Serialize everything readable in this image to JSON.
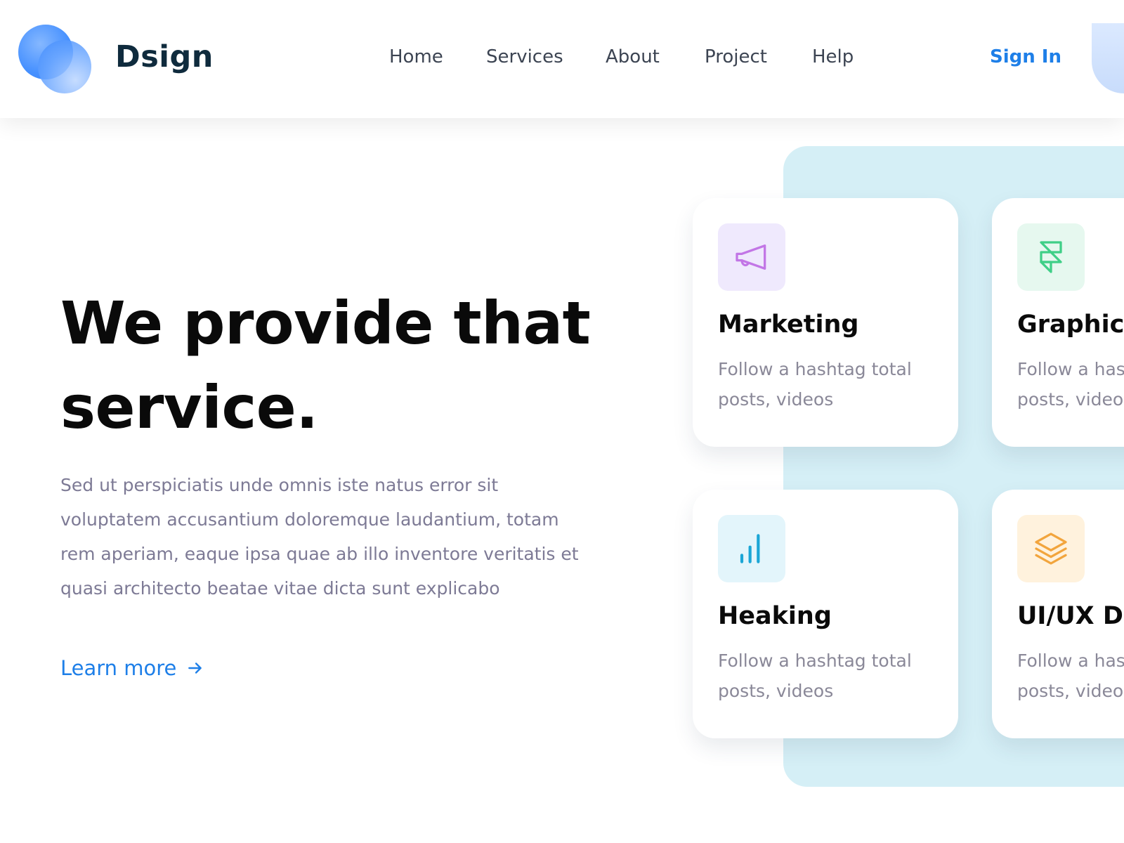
{
  "brand": {
    "name": "Dsign",
    "colors": {
      "primary": "#1e7fe8",
      "dark": "#0f2b3d"
    }
  },
  "nav": {
    "items": [
      {
        "label": "Home"
      },
      {
        "label": "Services"
      },
      {
        "label": "About"
      },
      {
        "label": "Project"
      },
      {
        "label": "Help"
      }
    ],
    "sign_in": "Sign In"
  },
  "hero": {
    "title": "We provide that service.",
    "description": "Sed ut perspiciatis unde omnis iste natus error sit voluptatem accusantium doloremque laudantium, totam rem aperiam, eaque ipsa quae ab illo inventore veritatis et quasi architecto beatae vitae dicta sunt explicabo",
    "cta": "Learn more"
  },
  "services": [
    {
      "title": "Marketing",
      "description": "Follow a hashtag total posts, videos",
      "icon": "megaphone-icon",
      "icon_color": "#c276e6",
      "icon_bg": "#efe9fd"
    },
    {
      "title": "Graphic",
      "description": "Follow a hashtag total posts, videos",
      "icon": "framer-icon",
      "icon_color": "#3fcf87",
      "icon_bg": "#e6f8ef"
    },
    {
      "title": "Heaking",
      "description": "Follow a hashtag total posts, videos",
      "icon": "bar-chart-icon",
      "icon_color": "#1ba6d6",
      "icon_bg": "#e3f5fb"
    },
    {
      "title": "UI/UX Design",
      "description": "Follow a hashtag total posts, videos",
      "icon": "layers-icon",
      "icon_color": "#f2a53d",
      "icon_bg": "#fff2dd"
    }
  ]
}
